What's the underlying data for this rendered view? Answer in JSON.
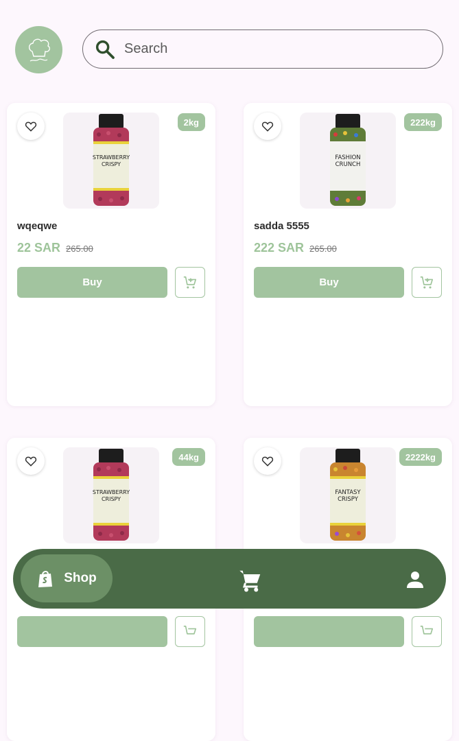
{
  "header": {
    "logo_icon": "chef-hat-logo-icon",
    "search": {
      "placeholder": "Search",
      "icon": "search-icon"
    }
  },
  "products": [
    {
      "name": "wqeqwe",
      "price": "22 SAR",
      "old_price": "265.00",
      "weight": "2kg",
      "buy_label": "Buy",
      "jar_color": "#b23a5a",
      "jar_label": "STRAWBERRY CRISPY"
    },
    {
      "name": "sadda 5555",
      "price": "222 SAR",
      "old_price": "265.00",
      "weight": "222kg",
      "buy_label": "Buy",
      "jar_color": "#6a8a3a",
      "jar_label": "FASHION CRUNCH"
    },
    {
      "name": "",
      "price": "",
      "old_price": "",
      "weight": "44kg",
      "buy_label": "",
      "jar_color": "#b23a5a",
      "jar_label": "STRAWBERRY CRISPY"
    },
    {
      "name": "",
      "price": "",
      "old_price": "",
      "weight": "2222kg",
      "buy_label": "",
      "jar_color": "#d08a3a",
      "jar_label": "FANTASY CRISPY"
    }
  ],
  "nav": {
    "shop_label": "Shop",
    "shop_icon": "shopping-bag-icon",
    "cart_icon": "cart-icon",
    "profile_icon": "person-icon"
  },
  "colors": {
    "accent": "#a2c49f",
    "nav_bg": "#4a6b47",
    "nav_active": "#6c9066",
    "background": "#fdf7fd"
  }
}
